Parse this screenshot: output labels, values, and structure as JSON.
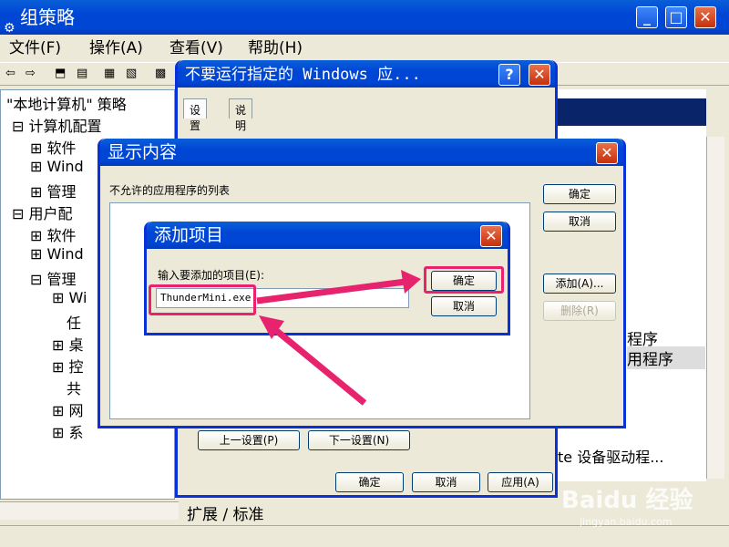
{
  "main": {
    "title": "组策略",
    "menu": [
      "文件(F)",
      "操作(A)",
      "查看(V)",
      "帮助(H)"
    ],
    "tree": {
      "root": "\"本地计算机\" 策略",
      "computer_config": "计算机配置",
      "software1": "软件",
      "windows1": "Wind",
      "admin1": "管理",
      "user_config": "用户配",
      "software2": "软件",
      "windows2": "Wind",
      "admin2": "管理",
      "sub": [
        "Wi",
        "任",
        "桌",
        "控",
        "共",
        "网",
        "系"
      ]
    },
    "right_items": [
      "程序",
      "用程序"
    ],
    "right_bottom_text": "te 设备驱动程...",
    "bottom_tabs": [
      "扩展",
      "标准"
    ]
  },
  "policy_dialog": {
    "title": "不要运行指定的 Windows 应...",
    "tabs": [
      "设置",
      "说明"
    ],
    "prev_button": "上一设置(P)",
    "next_button": "下一设置(N)",
    "ok": "确定",
    "cancel": "取消",
    "apply": "应用(A)"
  },
  "show_dialog": {
    "title": "显示内容",
    "list_label": "不允许的应用程序的列表",
    "ok": "确定",
    "cancel": "取消",
    "add": "添加(A)...",
    "remove": "删除(R)"
  },
  "add_dialog": {
    "title": "添加项目",
    "prompt": "输入要添加的项目(E):",
    "input_value": "ThunderMini.exe",
    "ok": "确定",
    "cancel": "取消"
  },
  "watermark": {
    "brand": "Baidu 经验",
    "url": "jingyan.baidu.com"
  },
  "colors": {
    "titlebar": "#0046d5",
    "highlight": "#e8236e",
    "window_bg": "#ece9d8"
  }
}
